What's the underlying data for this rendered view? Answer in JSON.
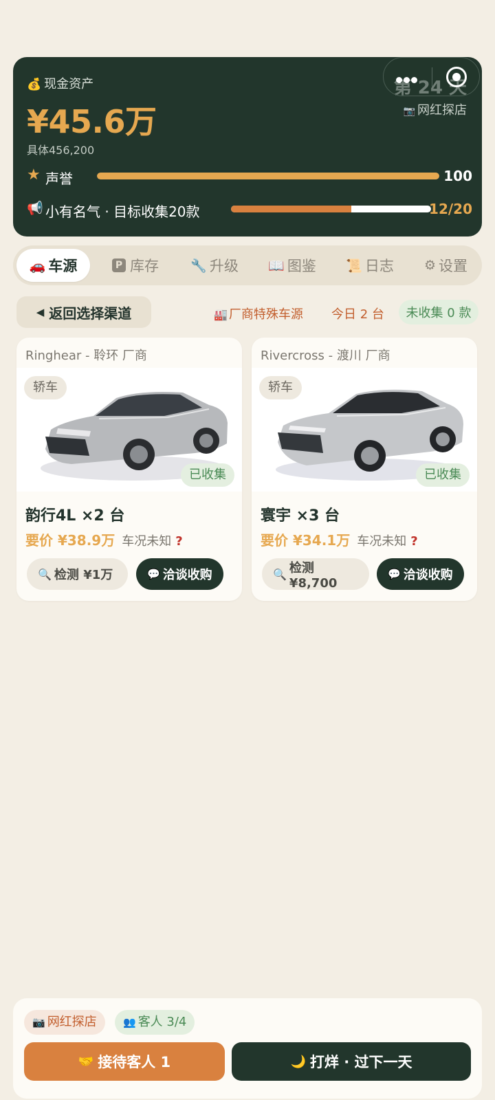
{
  "header": {
    "cash_label": "现金资产",
    "cash_amount": "¥45.6万",
    "cash_detail": "具体456,200",
    "day": "第 24 天",
    "event": "网红探店",
    "reputation": {
      "label": "声誉",
      "value": "100",
      "progress": 1.0
    },
    "fame": {
      "label": "小有名气 · 目标收集20款",
      "value": "12/20",
      "progress": 0.6
    }
  },
  "tabs": [
    {
      "label": "车源",
      "icon": "car-icon",
      "active": true
    },
    {
      "label": "库存",
      "icon": "parking-icon",
      "active": false
    },
    {
      "label": "升级",
      "icon": "wrench-icon",
      "active": false
    },
    {
      "label": "图鉴",
      "icon": "book-icon",
      "active": false
    },
    {
      "label": "日志",
      "icon": "scroll-icon",
      "active": false
    },
    {
      "label": "设置",
      "icon": "gear-icon",
      "active": false
    }
  ],
  "filter": {
    "back_label": "返回选择渠道",
    "channel": "厂商特殊车源",
    "today": "今日 2 台",
    "uncollected": "未收集 0 款"
  },
  "cars": [
    {
      "maker": "Ringhear - 聆环 厂商",
      "type": "轿车",
      "collected": "已收集",
      "name": "韵行4L ×2 台",
      "price": "要价 ¥38.9万",
      "condition": "车况未知",
      "unknown_mark": "?",
      "inspect_label": "检测 ¥1万",
      "negotiate_label": "洽谈收购"
    },
    {
      "maker": "Rivercross - 渡川 厂商",
      "type": "轿车",
      "collected": "已收集",
      "name": "寰宇 ×3 台",
      "price": "要价 ¥34.1万",
      "condition": "车况未知",
      "unknown_mark": "?",
      "inspect_label": "检测 ¥8,700",
      "negotiate_label": "洽谈收购"
    }
  ],
  "bottom": {
    "event_chip": "网红探店",
    "guests_chip": "客人 3/4",
    "guest_button": "接待客人 1",
    "next_day_button": "打烊 · 过下一天"
  },
  "colors": {
    "dark_green": "#22362c",
    "gold": "#e6a850",
    "orange": "#d9813f",
    "background": "#f3eee4"
  }
}
